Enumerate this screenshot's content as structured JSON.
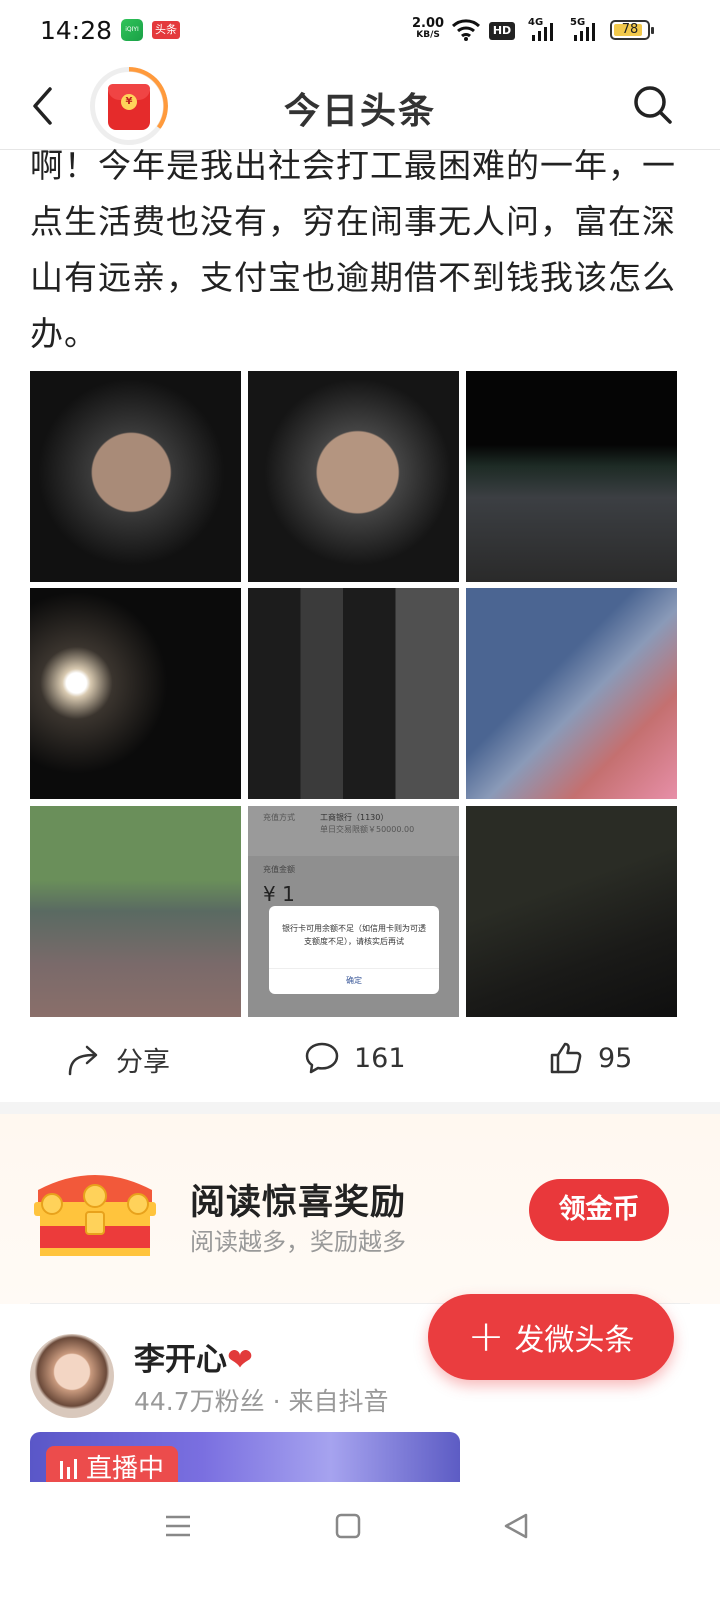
{
  "status_bar": {
    "time": "14:28",
    "app_badge_1": "iQIYI",
    "app_badge_2": "头条",
    "net_speed": "2.00",
    "net_speed_unit": "KB/S",
    "hd_label": "HD",
    "network_1": "4G",
    "network_2": "5G",
    "battery": "78"
  },
  "nav": {
    "title": "今日头条",
    "red_packet_symbol": "¥"
  },
  "article": {
    "text": "啊！今年是我出社会打工最困难的一年，一点生活费也没有，穷在闹事无人问，富在深山有远亲，支付宝也逾期借不到钱我该怎么办。"
  },
  "payment_screenshot": {
    "method_label": "充值方式",
    "bank": "工商银行（1130）",
    "limit": "单日交易限额￥50000.00",
    "amount_label": "充值金额",
    "amount": "¥ 1",
    "dialog_message": "银行卡可用余额不足（如信用卡则为可透支额度不足），请核实后再试",
    "dialog_ok": "确定"
  },
  "actions": {
    "share_label": "分享",
    "comment_count": "161",
    "like_count": "95"
  },
  "reward": {
    "title": "阅读惊喜奖励",
    "subtitle": "阅读越多，奖励越多",
    "button": "领金币"
  },
  "author": {
    "name": "李开心",
    "heart": "❤",
    "meta": "44.7万粉丝 · 来自抖音",
    "live_label": "直播中"
  },
  "fab": {
    "label": "发微头条",
    "plus": "+"
  },
  "colors": {
    "accent_red": "#e9383b",
    "battery_fill": "#f2c94c"
  }
}
